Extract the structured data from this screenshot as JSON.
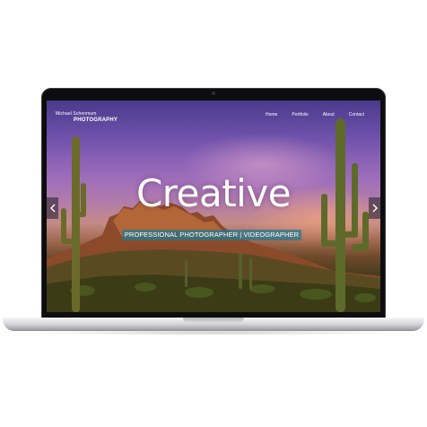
{
  "brand": {
    "name": "Michael Schenmum",
    "subtitle": "PHOTOGRAPHY"
  },
  "nav": {
    "items": [
      {
        "label": "Home"
      },
      {
        "label": "Portfolio"
      },
      {
        "label": "About"
      },
      {
        "label": "Contact"
      }
    ]
  },
  "hero": {
    "title": "Creative",
    "subtitle": "PROFESSIONAL PHOTOGRAPHER | VIDEOGRAPHER"
  },
  "slider": {
    "prev_icon": "chevron-left-icon",
    "next_icon": "chevron-right-icon"
  },
  "colors": {
    "sky_top": "#4a3a8c",
    "sky_mid": "#a06fb9",
    "subtitle_banner": "#28788c",
    "text": "#ffffff"
  }
}
